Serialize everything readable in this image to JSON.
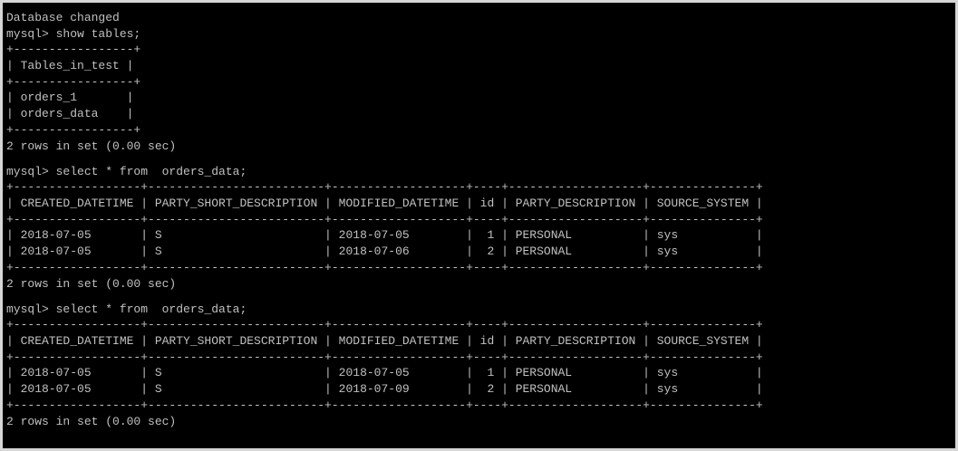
{
  "colors": {
    "background": "#000000",
    "foreground": "#c0c0c0",
    "outer_frame": "#d6d6d6"
  },
  "lines": [
    "Database changed",
    "mysql> show tables;",
    "+-----------------+",
    "| Tables_in_test |",
    "+-----------------+",
    "| orders_1       |",
    "| orders_data    |",
    "+-----------------+",
    "2 rows in set (0.00 sec)",
    "",
    "mysql> select * from  orders_data;",
    "+------------------+-------------------------+-------------------+----+-------------------+---------------+",
    "| CREATED_DATETIME | PARTY_SHORT_DESCRIPTION | MODIFIED_DATETIME | id | PARTY_DESCRIPTION | SOURCE_SYSTEM |",
    "+------------------+-------------------------+-------------------+----+-------------------+---------------+",
    "| 2018-07-05       | S                       | 2018-07-05        |  1 | PERSONAL          | sys           |",
    "| 2018-07-05       | S                       | 2018-07-06        |  2 | PERSONAL          | sys           |",
    "+------------------+-------------------------+-------------------+----+-------------------+---------------+",
    "2 rows in set (0.00 sec)",
    "",
    "mysql> select * from  orders_data;",
    "+------------------+-------------------------+-------------------+----+-------------------+---------------+",
    "| CREATED_DATETIME | PARTY_SHORT_DESCRIPTION | MODIFIED_DATETIME | id | PARTY_DESCRIPTION | SOURCE_SYSTEM |",
    "+------------------+-------------------------+-------------------+----+-------------------+---------------+",
    "| 2018-07-05       | S                       | 2018-07-05        |  1 | PERSONAL          | sys           |",
    "| 2018-07-05       | S                       | 2018-07-09        |  2 | PERSONAL          | sys           |",
    "+------------------+-------------------------+-------------------+----+-------------------+---------------+",
    "2 rows in set (0.00 sec)"
  ]
}
